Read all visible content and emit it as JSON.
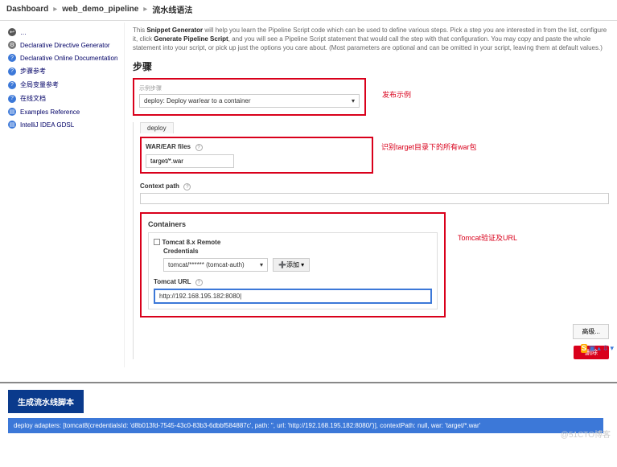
{
  "breadcrumb": {
    "root": "Dashboard",
    "project": "web_demo_pipeline",
    "page": "流水线语法"
  },
  "sidebar": {
    "items": [
      {
        "label": "…"
      },
      {
        "label": "Declarative Directive Generator"
      },
      {
        "label": "Declarative Online Documentation"
      },
      {
        "label": "步骤参考"
      },
      {
        "label": "全局变量参考"
      },
      {
        "label": "在线文档"
      },
      {
        "label": "Examples Reference"
      },
      {
        "label": "IntelliJ IDEA GDSL"
      }
    ]
  },
  "intro": {
    "text1": "This ",
    "bold1": "Snippet Generator",
    "text2": " will help you learn the Pipeline Script code which can be used to define various steps. Pick a step you are interested in from the list, configure it, click ",
    "bold2": "Generate Pipeline Script",
    "text3": ", and you will see a Pipeline Script statement that would call the step with that configuration. You may copy and paste the whole statement into your script, or pick up just the options you care about. (Most parameters are optional and can be omitted in your script, leaving them at default values.)"
  },
  "step": {
    "title": "步骤",
    "hint": "示例步骤",
    "selected": "deploy: Deploy war/ear to a container",
    "annotation": "发布示例"
  },
  "deploy": {
    "tab": "deploy",
    "war_label": "WAR/EAR files",
    "war_value": "target/*.war",
    "war_annotation": "识别target目录下的所有war包",
    "context_label": "Context path",
    "context_value": "",
    "containers_label": "Containers",
    "tomcat_title": "Tomcat 8.x Remote",
    "cred_label": "Credentials",
    "cred_value": "tomcat/****** (tomcat-auth)",
    "add_btn": "➕添加 ▾",
    "url_label": "Tomcat URL",
    "url_value": "http://192.168.195.182:8080|",
    "tomcat_annotation": "Tomcat验证及URL",
    "advanced": "高级...",
    "delete": "删除"
  },
  "bottom": {
    "generate_btn": "生成流水线脚本",
    "result": "deploy adapters: [tomcat8(credentialsId: 'd8b013fd-7545-43c0-83b3-6dbbf584887c', path: '', url: 'http://192.168.195.182:8080/')], contextPath: null, war: 'target/*.war'"
  },
  "watermark": "@51CTO博客"
}
